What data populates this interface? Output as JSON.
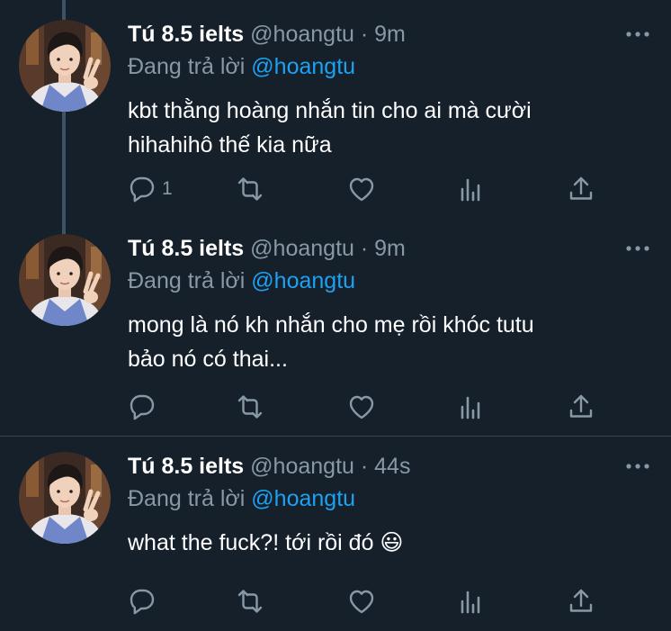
{
  "colors": {
    "background": "#15202b",
    "text_primary": "#ffffff",
    "text_secondary": "#8899a6",
    "mention": "#1da1f2",
    "thread_line": "#3d5466",
    "divider": "#38444d"
  },
  "tweets": [
    {
      "display_name": "Tú 8.5 ielts",
      "handle": "@hoangtu",
      "separator": "·",
      "time": "9m",
      "reply_prefix": "Đang trả lời",
      "reply_mention": "@hoangtu",
      "text_line1": "kbt thằng hoàng nhắn tin cho ai mà cười",
      "text_line2": "hihahihô thế kia nữa",
      "reply_count": "1",
      "icons": [
        "reply-icon",
        "retweet-icon",
        "like-icon",
        "analytics-icon",
        "share-icon",
        "more-icon"
      ]
    },
    {
      "display_name": "Tú 8.5 ielts",
      "handle": "@hoangtu",
      "separator": "·",
      "time": "9m",
      "reply_prefix": "Đang trả lời",
      "reply_mention": "@hoangtu",
      "text_line1": "mong là nó kh nhắn cho mẹ rồi khóc tutu",
      "text_line2": "bảo nó có thai...",
      "reply_count": "",
      "icons": [
        "reply-icon",
        "retweet-icon",
        "like-icon",
        "analytics-icon",
        "share-icon",
        "more-icon"
      ]
    },
    {
      "display_name": "Tú 8.5 ielts",
      "handle": "@hoangtu",
      "separator": "·",
      "time": "44s",
      "reply_prefix": "Đang trả lời",
      "reply_mention": "@hoangtu",
      "text_line1": "what the fuck?! tới rồi đó 😃",
      "text_line2": "",
      "reply_count": "",
      "icons": [
        "reply-icon",
        "retweet-icon",
        "like-icon",
        "analytics-icon",
        "share-icon",
        "more-icon"
      ]
    }
  ]
}
